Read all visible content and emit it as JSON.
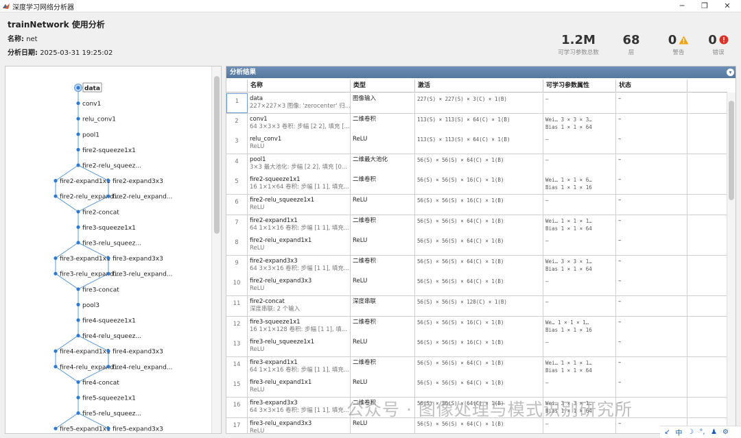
{
  "window": {
    "title": "深度学习网络分析器",
    "controls": {
      "minimize": "─",
      "maximize": "❐",
      "close": "✕"
    }
  },
  "header": {
    "title": "trainNetwork 使用分析",
    "name_label": "名称:",
    "name_value": "net",
    "date_label": "分析日期:",
    "date_value": "2025-03-31 19:25:02",
    "stats": [
      {
        "value": "1.2M",
        "label": "可学习参数总数"
      },
      {
        "value": "68",
        "label": "层"
      },
      {
        "value": "0",
        "label": "警告",
        "icon": "warning-icon",
        "color": "#f0a30a"
      },
      {
        "value": "0",
        "label": "错误",
        "icon": "error-icon",
        "color": "#d9342b"
      }
    ]
  },
  "graph": {
    "nodes": [
      "data",
      "conv1",
      "relu_conv1",
      "pool1",
      "fire2-squeeze1x1",
      "fire2-relu_squeez...",
      "fire2-expand1x1",
      "fire2-expand3x3",
      "fire2-relu_expand...",
      "fire2-relu_expand...",
      "fire2-concat",
      "fire3-squeeze1x1",
      "fire3-relu_squeez...",
      "fire3-expand1x1",
      "fire3-expand3x3",
      "fire3-relu_expand...",
      "fire3-relu_expand...",
      "fire3-concat",
      "pool3",
      "fire4-squeeze1x1",
      "fire4-relu_squeez...",
      "fire4-expand1x1",
      "fire4-expand3x3",
      "fire4-relu_expand...",
      "fire4-relu_expand...",
      "fire4-concat",
      "fire5-squeeze1x1",
      "fire5-relu_squeez...",
      "fire5-expand1x1",
      "fire5-expand3x3"
    ]
  },
  "results": {
    "title": "分析结果",
    "columns": [
      "名称",
      "类型",
      "激活",
      "可学习参数属性",
      "状态"
    ],
    "rows": [
      {
        "n": "1",
        "name": "data",
        "desc": "227×227×3 图像: 'zerocenter' 归...",
        "type": "图像输入",
        "act": "227(S) × 227(S) × 3(C) × 1(B)",
        "p1": "–",
        "p2": "",
        "state": "–"
      },
      {
        "n": "2",
        "name": "conv1",
        "desc": "64 3×3×3 卷积: 步幅 [2 2], 填充 [...",
        "type": "二维卷积",
        "act": "113(S) × 113(S) × 64(C) × 1(B)",
        "p1": "Wei…  3 × 3 × 3…",
        "p2": "Bias  1 × 1 × 64",
        "state": "–"
      },
      {
        "n": "3",
        "name": "relu_conv1",
        "desc": "ReLU",
        "type": "ReLU",
        "act": "113(S) × 113(S) × 64(C) × 1(B)",
        "p1": "–",
        "p2": "",
        "state": "–"
      },
      {
        "n": "4",
        "name": "pool1",
        "desc": "3×3 最大池化: 步幅 [2 2], 填充 [0...",
        "type": "二维最大池化",
        "act": "56(S) × 56(S) × 64(C) × 1(B)",
        "p1": "–",
        "p2": "",
        "state": "–"
      },
      {
        "n": "5",
        "name": "fire2-squeeze1x1",
        "desc": "16 1×1×64 卷积: 步幅 [1 1], 填充...",
        "type": "二维卷积",
        "act": "56(S) × 56(S) × 16(C) × 1(B)",
        "p1": "Wei…  1 × 1 × 6…",
        "p2": "Bias  1 × 1 × 16",
        "state": "–"
      },
      {
        "n": "6",
        "name": "fire2-relu_squeeze1x1",
        "desc": "ReLU",
        "type": "ReLU",
        "act": "56(S) × 56(S) × 16(C) × 1(B)",
        "p1": "–",
        "p2": "",
        "state": "–"
      },
      {
        "n": "7",
        "name": "fire2-expand1x1",
        "desc": "64 1×1×16 卷积: 步幅 [1 1], 填充...",
        "type": "二维卷积",
        "act": "56(S) × 56(S) × 64(C) × 1(B)",
        "p1": "Wei…  1 × 1 × 1…",
        "p2": "Bias  1 × 1 × 64",
        "state": "–"
      },
      {
        "n": "8",
        "name": "fire2-relu_expand1x1",
        "desc": "ReLU",
        "type": "ReLU",
        "act": "56(S) × 56(S) × 64(C) × 1(B)",
        "p1": "–",
        "p2": "",
        "state": "–"
      },
      {
        "n": "9",
        "name": "fire2-expand3x3",
        "desc": "64 3×3×16 卷积: 步幅 [1 1], 填充...",
        "type": "二维卷积",
        "act": "56(S) × 56(S) × 64(C) × 1(B)",
        "p1": "Wei…  3 × 3 × 1…",
        "p2": "Bias  1 × 1 × 64",
        "state": "–"
      },
      {
        "n": "10",
        "name": "fire2-relu_expand3x3",
        "desc": "ReLU",
        "type": "ReLU",
        "act": "56(S) × 56(S) × 64(C) × 1(B)",
        "p1": "–",
        "p2": "",
        "state": "–"
      },
      {
        "n": "11",
        "name": "fire2-concat",
        "desc": "深度串联: 2 个输入",
        "type": "深度串联",
        "act": "56(S) × 56(S) × 128(C) × 1(B)",
        "p1": "–",
        "p2": "",
        "state": "–"
      },
      {
        "n": "12",
        "name": "fire3-squeeze1x1",
        "desc": "16 1×1×128 卷积: 步幅 [1 1], 填...",
        "type": "二维卷积",
        "act": "56(S) × 56(S) × 16(C) × 1(B)",
        "p1": "We…  1 × 1 × 1…",
        "p2": "Bias  1 × 1 × 16",
        "state": "–"
      },
      {
        "n": "13",
        "name": "fire3-relu_squeeze1x1",
        "desc": "ReLU",
        "type": "ReLU",
        "act": "56(S) × 56(S) × 16(C) × 1(B)",
        "p1": "–",
        "p2": "",
        "state": "–"
      },
      {
        "n": "14",
        "name": "fire3-expand1x1",
        "desc": "64 1×1×16 卷积: 步幅 [1 1], 填充...",
        "type": "二维卷积",
        "act": "56(S) × 56(S) × 64(C) × 1(B)",
        "p1": "Wei…  1 × 1 × 1…",
        "p2": "Bias  1 × 1 × 64",
        "state": "–"
      },
      {
        "n": "15",
        "name": "fire3-relu_expand1x1",
        "desc": "ReLU",
        "type": "ReLU",
        "act": "56(S) × 56(S) × 64(C) × 1(B)",
        "p1": "–",
        "p2": "",
        "state": "–"
      },
      {
        "n": "16",
        "name": "fire3-expand3x3",
        "desc": "64 3×3×16 卷积: 步幅 [1 1], 填充...",
        "type": "二维卷积",
        "act": "56(S) × 56(S) × 64(C) × 1(B)",
        "p1": "Wei…  3 × 3 × 1…",
        "p2": "Bias  1 × 1 × 64",
        "state": "–"
      },
      {
        "n": "17",
        "name": "fire3-relu_expand3x3",
        "desc": "ReLU",
        "type": "ReLU",
        "act": "56(S) × 56(S) × 64(C) × 1(B)",
        "p1": "–",
        "p2": "",
        "state": "–"
      }
    ]
  },
  "watermark": "公众号 · 图像处理与模式识别研究所",
  "tray": {
    "items": [
      "↙",
      "中",
      "☽",
      "°,",
      "♟",
      "⚙"
    ]
  }
}
